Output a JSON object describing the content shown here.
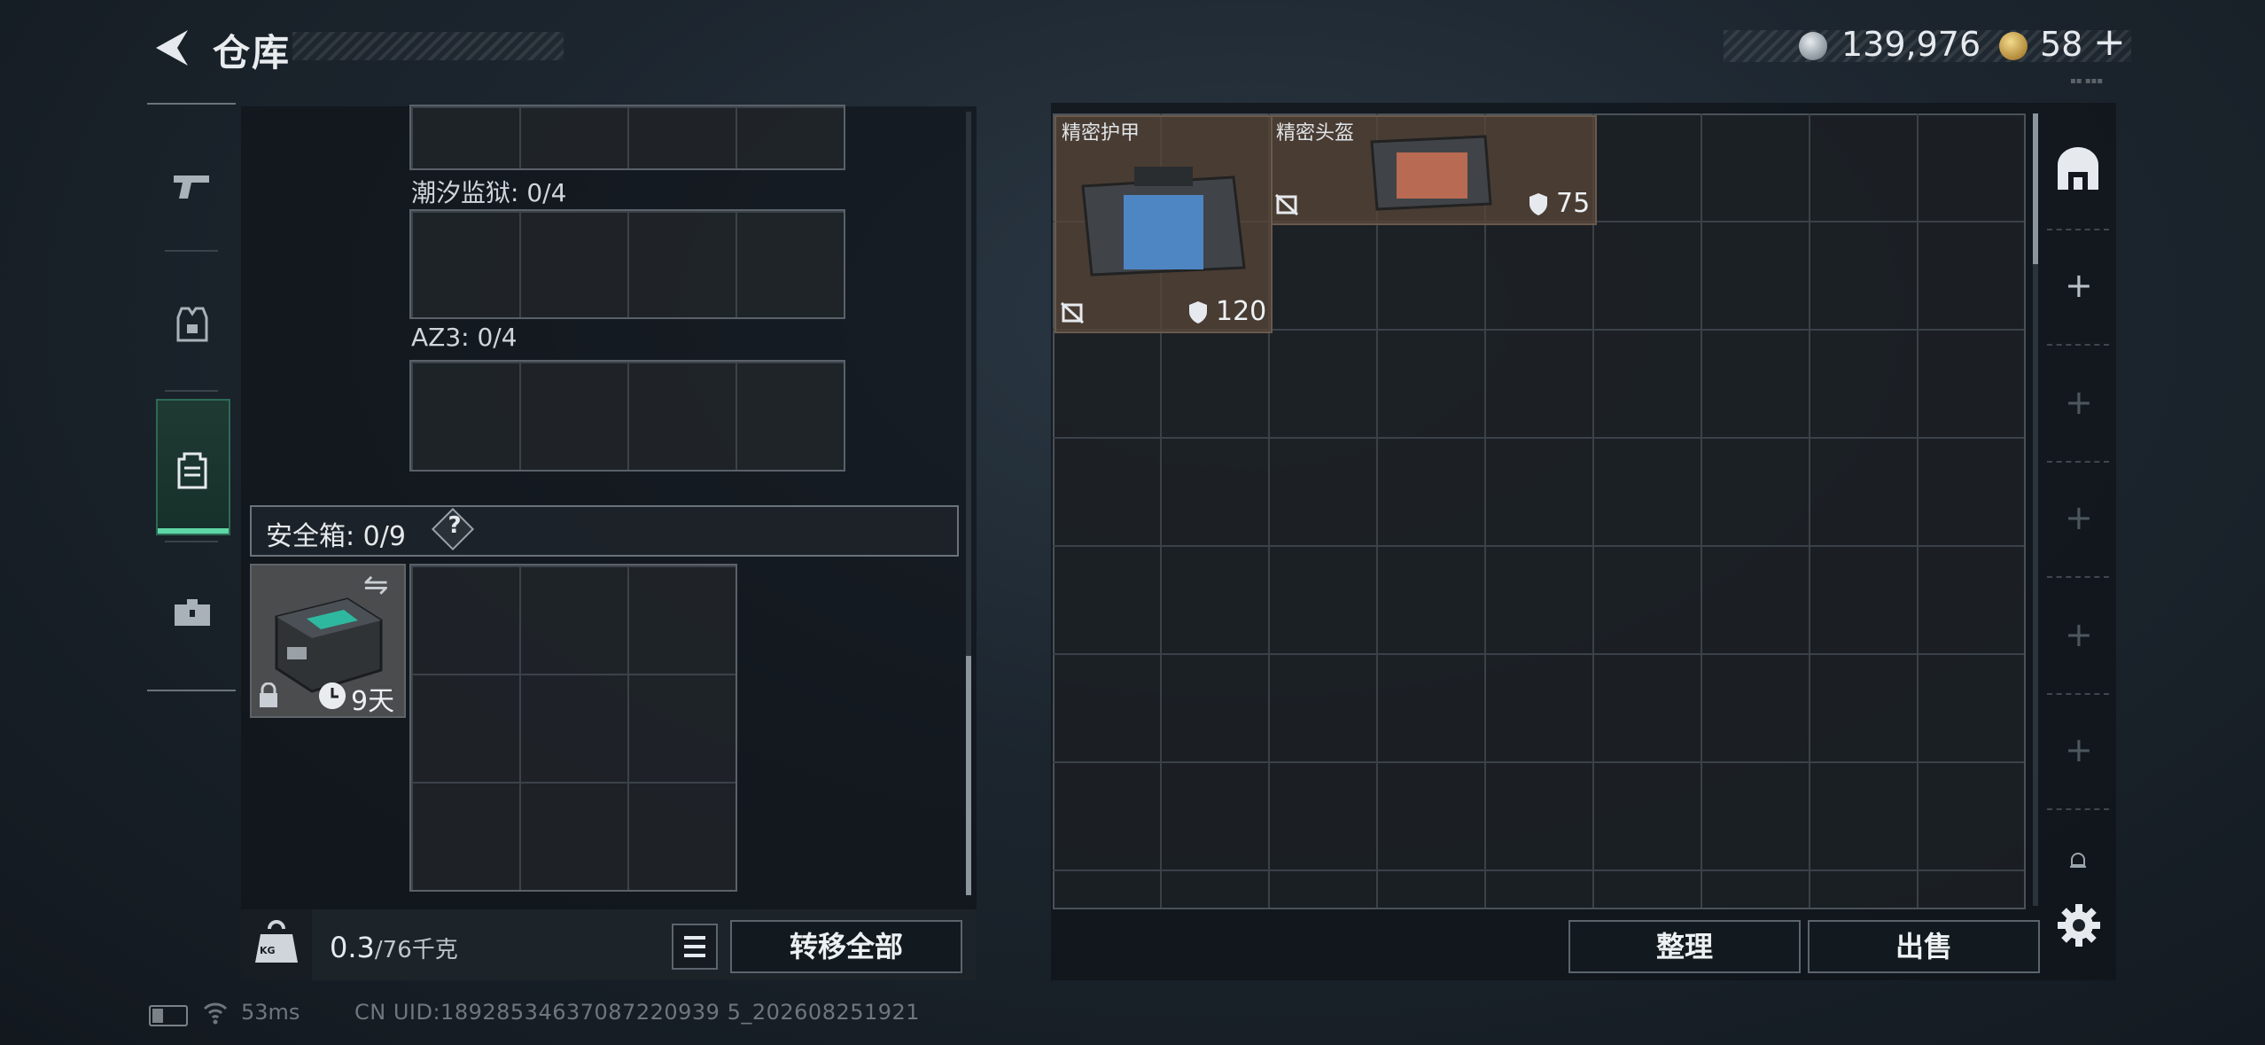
{
  "header": {
    "title": "仓库",
    "silver_amount": "139,976",
    "gold_amount": "58",
    "plus_label": "+"
  },
  "left_rail": {
    "items": [
      "pistol-icon",
      "armor-vest-icon",
      "backpack-icon",
      "toolbox-icon"
    ],
    "active_index": 2
  },
  "slots": {
    "tide_prison_label": "潮汐监狱: 0/4",
    "az3_label": "AZ3: 0/4",
    "safebox_label": "安全箱: 0/9",
    "help_label": "?",
    "safebox_days": "9天"
  },
  "bottom_left": {
    "weight_current": "0.3",
    "weight_max": "/76千克",
    "kg_badge": "KG",
    "transfer_all_label": "转移全部"
  },
  "inventory": {
    "items": [
      {
        "name": "精密护甲",
        "value": "120"
      },
      {
        "name": "精密头盔",
        "value": "75"
      }
    ]
  },
  "bottom_right": {
    "sort_label": "整理",
    "sell_label": "出售"
  },
  "side_rail": {
    "plus_label": "+"
  },
  "footer": {
    "ping": "53ms",
    "uid": "CN UID:18928534637087220939 5_202608251921"
  },
  "colors": {
    "accent_green": "#5fd6a6",
    "item_bg": "#58463a"
  }
}
